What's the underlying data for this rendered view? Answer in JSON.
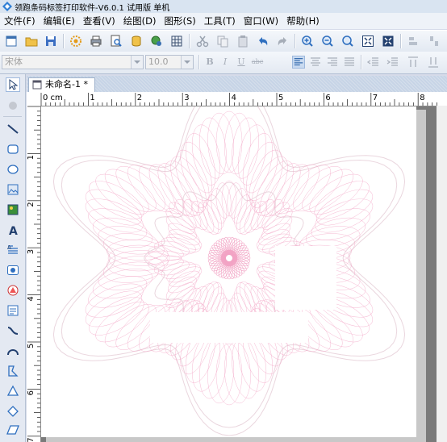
{
  "window": {
    "title": "领跑条码标签打印软件-V6.0.1 试用版 单机"
  },
  "menu": [
    "文件(F)",
    "编辑(E)",
    "查看(V)",
    "绘图(D)",
    "图形(S)",
    "工具(T)",
    "窗口(W)",
    "帮助(H)"
  ],
  "format_bar": {
    "font_name": "宋体",
    "font_size": "10.0",
    "bold": "B",
    "italic": "I",
    "underline": "U",
    "strike": "abc"
  },
  "document": {
    "tab_label": "未命名-1 *"
  },
  "ruler": {
    "h_labels": [
      "0 cm",
      "1",
      "2",
      "3",
      "4",
      "5",
      "6",
      "7",
      "8"
    ],
    "v_labels": [
      "1",
      "2",
      "3",
      "4",
      "5",
      "6",
      "7"
    ]
  },
  "colors": {
    "guilloche": "#f2a3c4",
    "guilloche_outline": "#ead6de",
    "workspace": "#7a7a7a"
  },
  "icons": {
    "toolbar": [
      "new-icon",
      "open-icon",
      "save-icon",
      "settings-icon",
      "print-icon",
      "print-preview-icon",
      "database-icon",
      "data-source-icon",
      "grid-icon",
      "cut-icon",
      "copy-icon",
      "paste-icon",
      "undo-icon",
      "redo-icon",
      "zoom-in-icon",
      "zoom-out-icon",
      "zoom-fit-icon",
      "fit-page-icon",
      "actual-size-icon",
      "align-icon",
      "distribute-icon"
    ],
    "tools": [
      "select-icon",
      "pan-icon",
      "line-icon",
      "rounded-rect-icon",
      "ellipse-icon",
      "image-icon",
      "picture-icon",
      "text-icon",
      "paragraph-icon",
      "barcode-icon",
      "shape-icon",
      "table-icon",
      "curve-icon",
      "arc-icon",
      "polyline-icon",
      "triangle-icon",
      "diamond-icon",
      "parallelogram-icon"
    ]
  }
}
